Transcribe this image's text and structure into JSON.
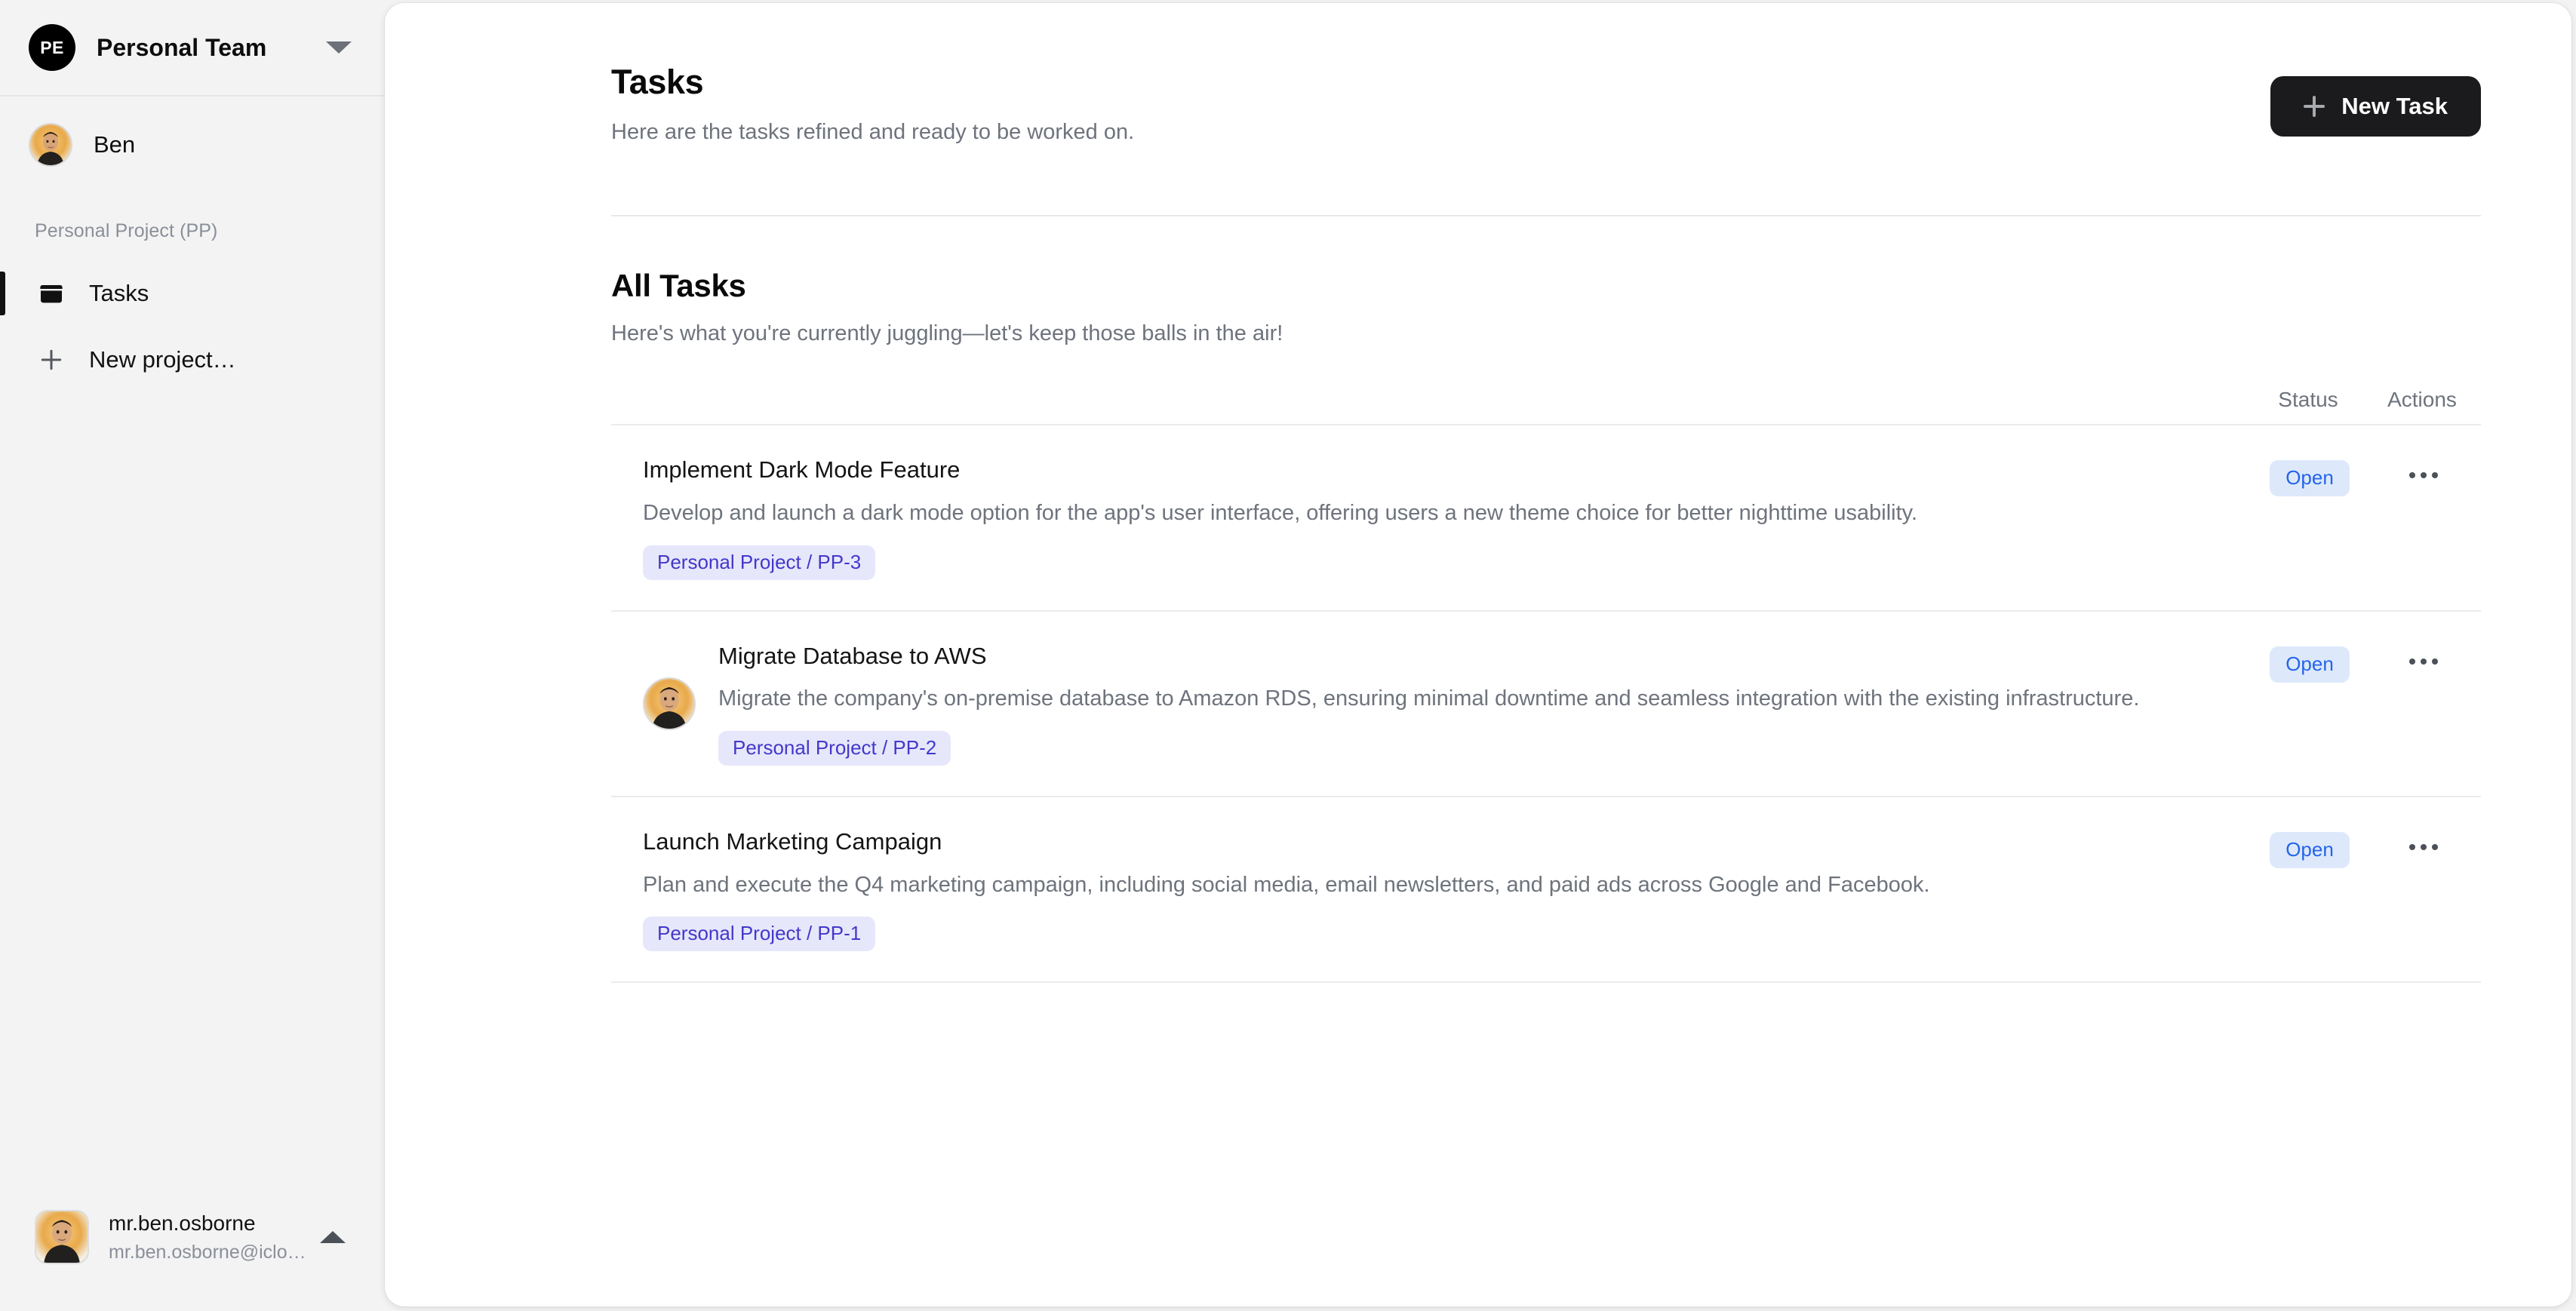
{
  "sidebar": {
    "team": {
      "initials": "PE",
      "name": "Personal Team",
      "chevron_icon": "chevron-down-icon"
    },
    "user": {
      "name": "Ben"
    },
    "project_section_label": "Personal Project (PP)",
    "nav_items": [
      {
        "label": "Tasks",
        "icon": "archive-box-icon",
        "active": true
      },
      {
        "label": "New project…",
        "icon": "plus-icon",
        "active": false
      }
    ],
    "account": {
      "name": "mr.ben.osborne",
      "email": "mr.ben.osborne@iclo…",
      "chevron_icon": "chevron-up-icon"
    }
  },
  "header": {
    "title": "Tasks",
    "subtitle": "Here are the tasks refined and ready to be worked on.",
    "new_task_button": "New Task",
    "new_task_icon": "plus-icon"
  },
  "section": {
    "title": "All Tasks",
    "subtitle": "Here's what you're currently juggling—let's keep those balls in the air!"
  },
  "table": {
    "columns": {
      "status": "Status",
      "actions": "Actions"
    },
    "rows": [
      {
        "title": "Implement Dark Mode Feature",
        "description": "Develop and launch a dark mode option for the app's user interface, offering users a new theme choice for better nighttime usability.",
        "badge": "Personal Project / PP-3",
        "status": "Open",
        "has_avatar": false,
        "actions_icon": "ellipsis-horizontal-icon"
      },
      {
        "title": "Migrate Database to AWS",
        "description": "Migrate the company's on-premise database to Amazon RDS, ensuring minimal downtime and seamless integration with the existing infrastructure.",
        "badge": "Personal Project / PP-2",
        "status": "Open",
        "has_avatar": true,
        "actions_icon": "ellipsis-horizontal-icon"
      },
      {
        "title": "Launch Marketing Campaign",
        "description": "Plan and execute the Q4 marketing campaign, including social media, email newsletters, and paid ads across Google and Facebook.",
        "badge": "Personal Project / PP-1",
        "status": "Open",
        "has_avatar": false,
        "actions_icon": "ellipsis-horizontal-icon"
      }
    ]
  },
  "colors": {
    "sidebar_bg": "#f3f3f3",
    "panel_bg": "#ffffff",
    "accent_dark": "#1b1b1d",
    "badge_bg": "#e6e7fb",
    "badge_text": "#4338ca",
    "status_bg": "#dde9fb",
    "status_text": "#2563eb",
    "muted_text": "#6e737c"
  }
}
